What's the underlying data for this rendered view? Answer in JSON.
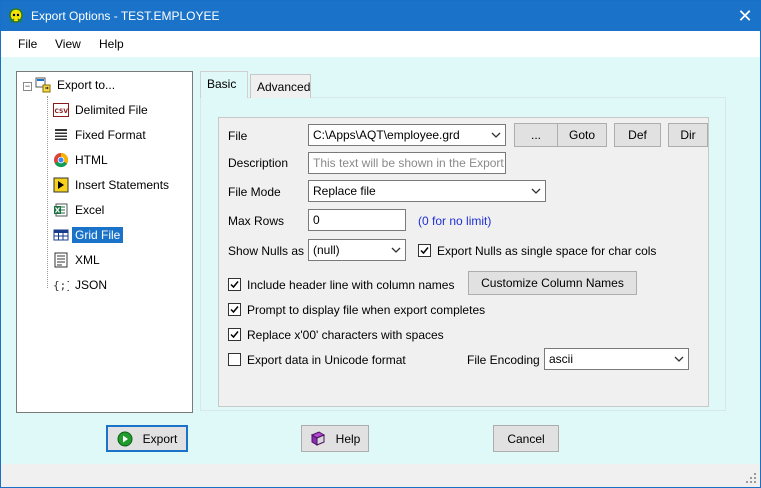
{
  "window": {
    "title": "Export Options - TEST.EMPLOYEE"
  },
  "menu": {
    "items": [
      "File",
      "View",
      "Help"
    ]
  },
  "tree": {
    "root": {
      "label": "Export to...",
      "icon": "export-icon"
    },
    "items": [
      {
        "label": "Delimited File",
        "icon": "csv-icon"
      },
      {
        "label": "Fixed Format",
        "icon": "fixed-format-icon"
      },
      {
        "label": "HTML",
        "icon": "chrome-icon"
      },
      {
        "label": "Insert Statements",
        "icon": "insert-statements-icon"
      },
      {
        "label": "Excel",
        "icon": "excel-icon"
      },
      {
        "label": "Grid File",
        "icon": "grid-icon",
        "selected": true
      },
      {
        "label": "XML",
        "icon": "xml-icon"
      },
      {
        "label": "JSON",
        "icon": "json-icon"
      }
    ]
  },
  "tabs": {
    "basic": "Basic",
    "advanced": "Advanced",
    "active": "Basic"
  },
  "form": {
    "file": {
      "label": "File",
      "value": "C:\\Apps\\AQT\\employee.grd"
    },
    "buttons": {
      "browse": "...",
      "goto": "Goto",
      "def": "Def",
      "dir": "Dir"
    },
    "description": {
      "label": "Description",
      "placeholder": "This text will be shown in the Export"
    },
    "file_mode": {
      "label": "File Mode",
      "value": "Replace file"
    },
    "max_rows": {
      "label": "Max Rows",
      "value": "0",
      "hint": "(0 for no limit)"
    },
    "show_nulls": {
      "label": "Show Nulls as",
      "value": "(null)"
    },
    "export_nulls": {
      "label": "Export Nulls as single space for char cols",
      "checked": true
    },
    "include_header": {
      "label": "Include header line with column names",
      "checked": true
    },
    "customize_columns": "Customize Column Names",
    "prompt_display": {
      "label": "Prompt to display file when export completes",
      "checked": true
    },
    "replace_x00": {
      "label": "Replace x'00' characters with spaces",
      "checked": true
    },
    "unicode": {
      "label": "Export data in Unicode format",
      "checked": false
    },
    "file_encoding": {
      "label": "File Encoding",
      "value": "ascii"
    }
  },
  "footer": {
    "export": "Export",
    "help": "Help",
    "cancel": "Cancel"
  },
  "colors": {
    "accent": "#1a73c9",
    "background": "#dff8f8",
    "hint": "#1f2fd6"
  }
}
